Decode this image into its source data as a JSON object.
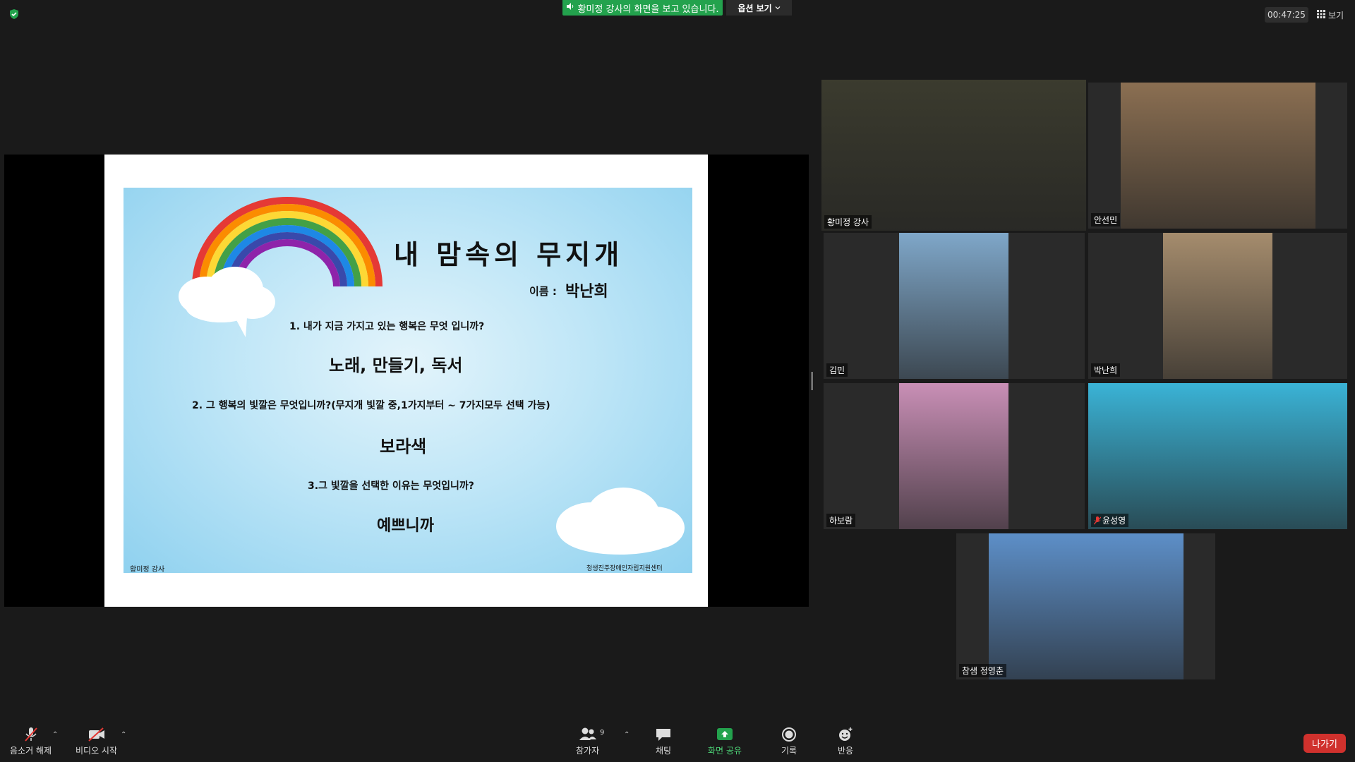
{
  "top_bar": {
    "share_banner": "황미정 강사의 화면을 보고 있습니다.",
    "view_options": "옵션 보기",
    "timer": "00:47:25",
    "view_button": "보기"
  },
  "slide": {
    "title": "내 맘속의 무지개",
    "name_label": "이름 :",
    "name_value": "박난희",
    "q1": "1. 내가 지금 가지고 있는 행복은 무엇 입니까?",
    "a1": "노래, 만들기, 독서",
    "q2": "2. 그 행복의 빛깔은 무엇입니까?(무지개 빛깔 중,1가지부터 ~ 7가지모두 선택 가능)",
    "a2": "보라색",
    "q3": "3.그 빛깔을 선택한 이유는 무엇입니까?",
    "a3": "예쁘니까",
    "footer_left": "황미정 강사",
    "footer_right": "청생진주장애인자립지원센터"
  },
  "participants": [
    {
      "name": "황미정 강사",
      "active": true,
      "muted": false,
      "video_color": "#3b3b2e"
    },
    {
      "name": "안선민",
      "active": false,
      "muted": false,
      "video_color": "#8b6f52"
    },
    {
      "name": "김민",
      "active": false,
      "muted": false,
      "video_color": "#7fa7c9"
    },
    {
      "name": "박난희",
      "active": false,
      "muted": false,
      "video_color": "#a58c6d"
    },
    {
      "name": "하보람",
      "active": false,
      "muted": false,
      "video_color": "#c98fb6"
    },
    {
      "name": "윤성영",
      "active": false,
      "muted": true,
      "video_color": "#3ab3d6"
    },
    {
      "name": "참샘 정영춘",
      "active": false,
      "muted": false,
      "video_color": "#5d8fc8"
    }
  ],
  "toolbar": {
    "unmute": "음소거 해제",
    "start_video": "비디오 시작",
    "participants": "참가자",
    "participants_count": "9",
    "chat": "채팅",
    "share_screen": "화면 공유",
    "record": "기록",
    "reactions": "반응",
    "leave": "나가기"
  },
  "colors": {
    "share_green": "#23a24d",
    "active_speaker": "#c9e26a",
    "leave_red": "#d0312d"
  }
}
